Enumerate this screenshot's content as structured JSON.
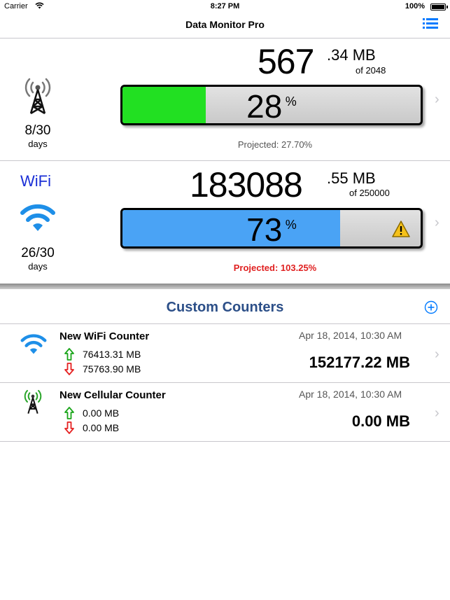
{
  "status_bar": {
    "carrier": "Carrier",
    "time": "8:27 PM",
    "battery": "100%"
  },
  "nav": {
    "title": "Data Monitor Pro"
  },
  "cellular": {
    "value_int": "567",
    "value_dec": ".34",
    "unit": "MB",
    "of_label": "of 2048",
    "percent": "28",
    "percent_sign": "%",
    "fill_fraction": 0.28,
    "days": "8/30",
    "days_label": "days",
    "projected": "Projected: 27.70%"
  },
  "wifi": {
    "label": "WiFi",
    "value_int": "183088",
    "value_dec": ".55",
    "unit": "MB",
    "of_label": "of 250000",
    "percent": "73",
    "percent_sign": "%",
    "fill_fraction": 0.73,
    "days": "26/30",
    "days_label": "days",
    "projected": "Projected: 103.25%"
  },
  "custom_counters": {
    "title": "Custom Counters",
    "items": [
      {
        "name": "New WiFi Counter",
        "date": "Apr 18, 2014, 10:30 AM",
        "up": "76413.31 MB",
        "down": "75763.90 MB",
        "total": "152177.22 MB"
      },
      {
        "name": "New Cellular Counter",
        "date": "Apr 18, 2014, 10:30 AM",
        "up": "0.00 MB",
        "down": "0.00 MB",
        "total": "0.00 MB"
      }
    ]
  },
  "colors": {
    "cell_fill": "#22e022",
    "wifi_fill": "#4aa3f5",
    "accent": "#007aff",
    "warning_red": "#e02020",
    "up_green": "#1aa51a",
    "down_red": "#e52222"
  }
}
